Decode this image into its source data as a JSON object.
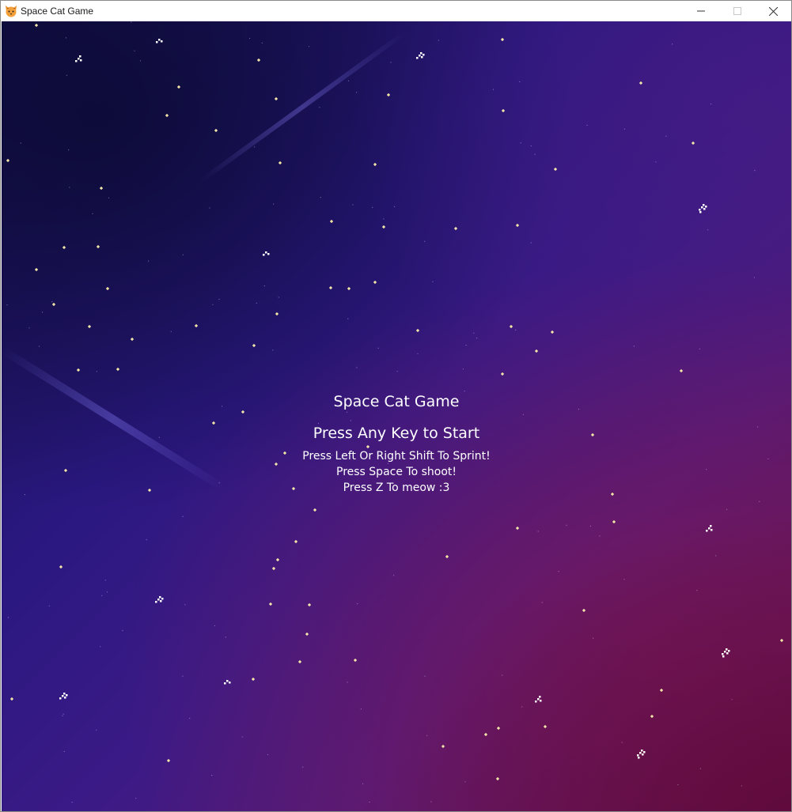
{
  "window": {
    "title": "Space Cat Game",
    "icon": "cat-face-icon",
    "controls": [
      "minimize-icon",
      "maximize-icon",
      "close-icon"
    ]
  },
  "menu": {
    "title": "Space Cat Game",
    "start_prompt": "Press Any Key to Start",
    "instructions": [
      "Press Left Or Right Shift To Sprint!",
      "Press Space To shoot!",
      "Press Z To meow :3"
    ]
  },
  "colors": {
    "text": "#ffffff",
    "star": "#f3e6a8",
    "space_dark": "#150f4a",
    "space_purple": "#3b1a86",
    "nebula_magenta": "#5e1459"
  }
}
